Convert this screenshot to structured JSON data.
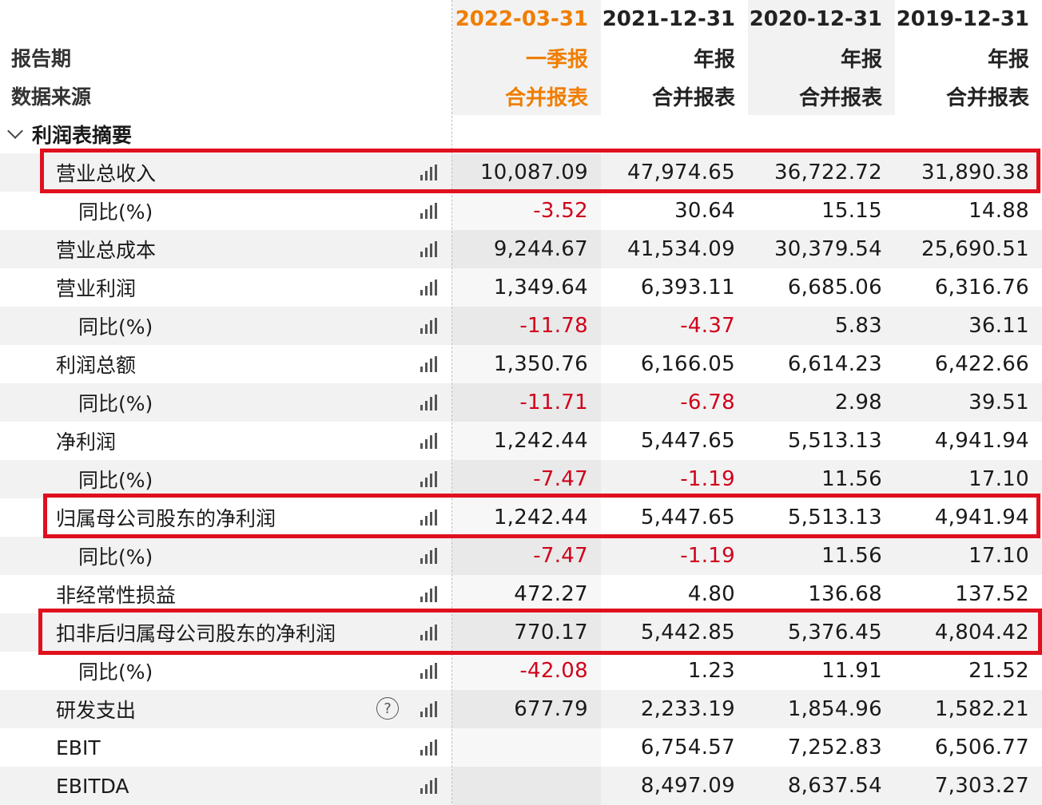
{
  "header": {
    "dates": [
      "2022-03-31",
      "2021-12-31",
      "2020-12-31",
      "2019-12-31"
    ],
    "report_period_label": "报告期",
    "periods": [
      "一季报",
      "年报",
      "年报",
      "年报"
    ],
    "data_source_label": "数据来源",
    "sources": [
      "合并报表",
      "合并报表",
      "合并报表",
      "合并报表"
    ],
    "accent_color": "#f07d00"
  },
  "section": {
    "title": "利润表摘要",
    "icon": "chevron-down-icon"
  },
  "rows": [
    {
      "label": "营业总收入",
      "level": 1,
      "values": [
        "10,087.09",
        "47,974.65",
        "36,722.72",
        "31,890.38"
      ],
      "neg": [
        false,
        false,
        false,
        false
      ],
      "highlighted": true
    },
    {
      "label": "同比(%)",
      "level": 2,
      "values": [
        "-3.52",
        "30.64",
        "15.15",
        "14.88"
      ],
      "neg": [
        true,
        false,
        false,
        false
      ]
    },
    {
      "label": "营业总成本",
      "level": 1,
      "values": [
        "9,244.67",
        "41,534.09",
        "30,379.54",
        "25,690.51"
      ],
      "neg": [
        false,
        false,
        false,
        false
      ]
    },
    {
      "label": "营业利润",
      "level": 1,
      "values": [
        "1,349.64",
        "6,393.11",
        "6,685.06",
        "6,316.76"
      ],
      "neg": [
        false,
        false,
        false,
        false
      ]
    },
    {
      "label": "同比(%)",
      "level": 2,
      "values": [
        "-11.78",
        "-4.37",
        "5.83",
        "36.11"
      ],
      "neg": [
        true,
        true,
        false,
        false
      ]
    },
    {
      "label": "利润总额",
      "level": 1,
      "values": [
        "1,350.76",
        "6,166.05",
        "6,614.23",
        "6,422.66"
      ],
      "neg": [
        false,
        false,
        false,
        false
      ]
    },
    {
      "label": "同比(%)",
      "level": 2,
      "values": [
        "-11.71",
        "-6.78",
        "2.98",
        "39.51"
      ],
      "neg": [
        true,
        true,
        false,
        false
      ]
    },
    {
      "label": "净利润",
      "level": 1,
      "values": [
        "1,242.44",
        "5,447.65",
        "5,513.13",
        "4,941.94"
      ],
      "neg": [
        false,
        false,
        false,
        false
      ]
    },
    {
      "label": "同比(%)",
      "level": 2,
      "values": [
        "-7.47",
        "-1.19",
        "11.56",
        "17.10"
      ],
      "neg": [
        true,
        true,
        false,
        false
      ]
    },
    {
      "label": "归属母公司股东的净利润",
      "level": 1,
      "values": [
        "1,242.44",
        "5,447.65",
        "5,513.13",
        "4,941.94"
      ],
      "neg": [
        false,
        false,
        false,
        false
      ],
      "highlighted": true
    },
    {
      "label": "同比(%)",
      "level": 2,
      "values": [
        "-7.47",
        "-1.19",
        "11.56",
        "17.10"
      ],
      "neg": [
        true,
        true,
        false,
        false
      ]
    },
    {
      "label": "非经常性损益",
      "level": 1,
      "values": [
        "472.27",
        "4.80",
        "136.68",
        "137.52"
      ],
      "neg": [
        false,
        false,
        false,
        false
      ]
    },
    {
      "label": "扣非后归属母公司股东的净利润",
      "level": 1,
      "values": [
        "770.17",
        "5,442.85",
        "5,376.45",
        "4,804.42"
      ],
      "neg": [
        false,
        false,
        false,
        false
      ],
      "highlighted": true
    },
    {
      "label": "同比(%)",
      "level": 2,
      "values": [
        "-42.08",
        "1.23",
        "11.91",
        "21.52"
      ],
      "neg": [
        true,
        false,
        false,
        false
      ]
    },
    {
      "label": "研发支出",
      "level": 1,
      "values": [
        "677.79",
        "2,233.19",
        "1,854.96",
        "1,582.21"
      ],
      "neg": [
        false,
        false,
        false,
        false
      ],
      "help": "?"
    },
    {
      "label": "EBIT",
      "level": 1,
      "values": [
        "",
        "6,754.57",
        "7,252.83",
        "6,506.77"
      ],
      "neg": [
        false,
        false,
        false,
        false
      ]
    },
    {
      "label": "EBITDA",
      "level": 1,
      "values": [
        "",
        "8,497.09",
        "8,637.54",
        "7,303.27"
      ],
      "neg": [
        false,
        false,
        false,
        false
      ]
    }
  ],
  "colors": {
    "negative": "#d0021b",
    "highlight_border": "#e0101e"
  }
}
